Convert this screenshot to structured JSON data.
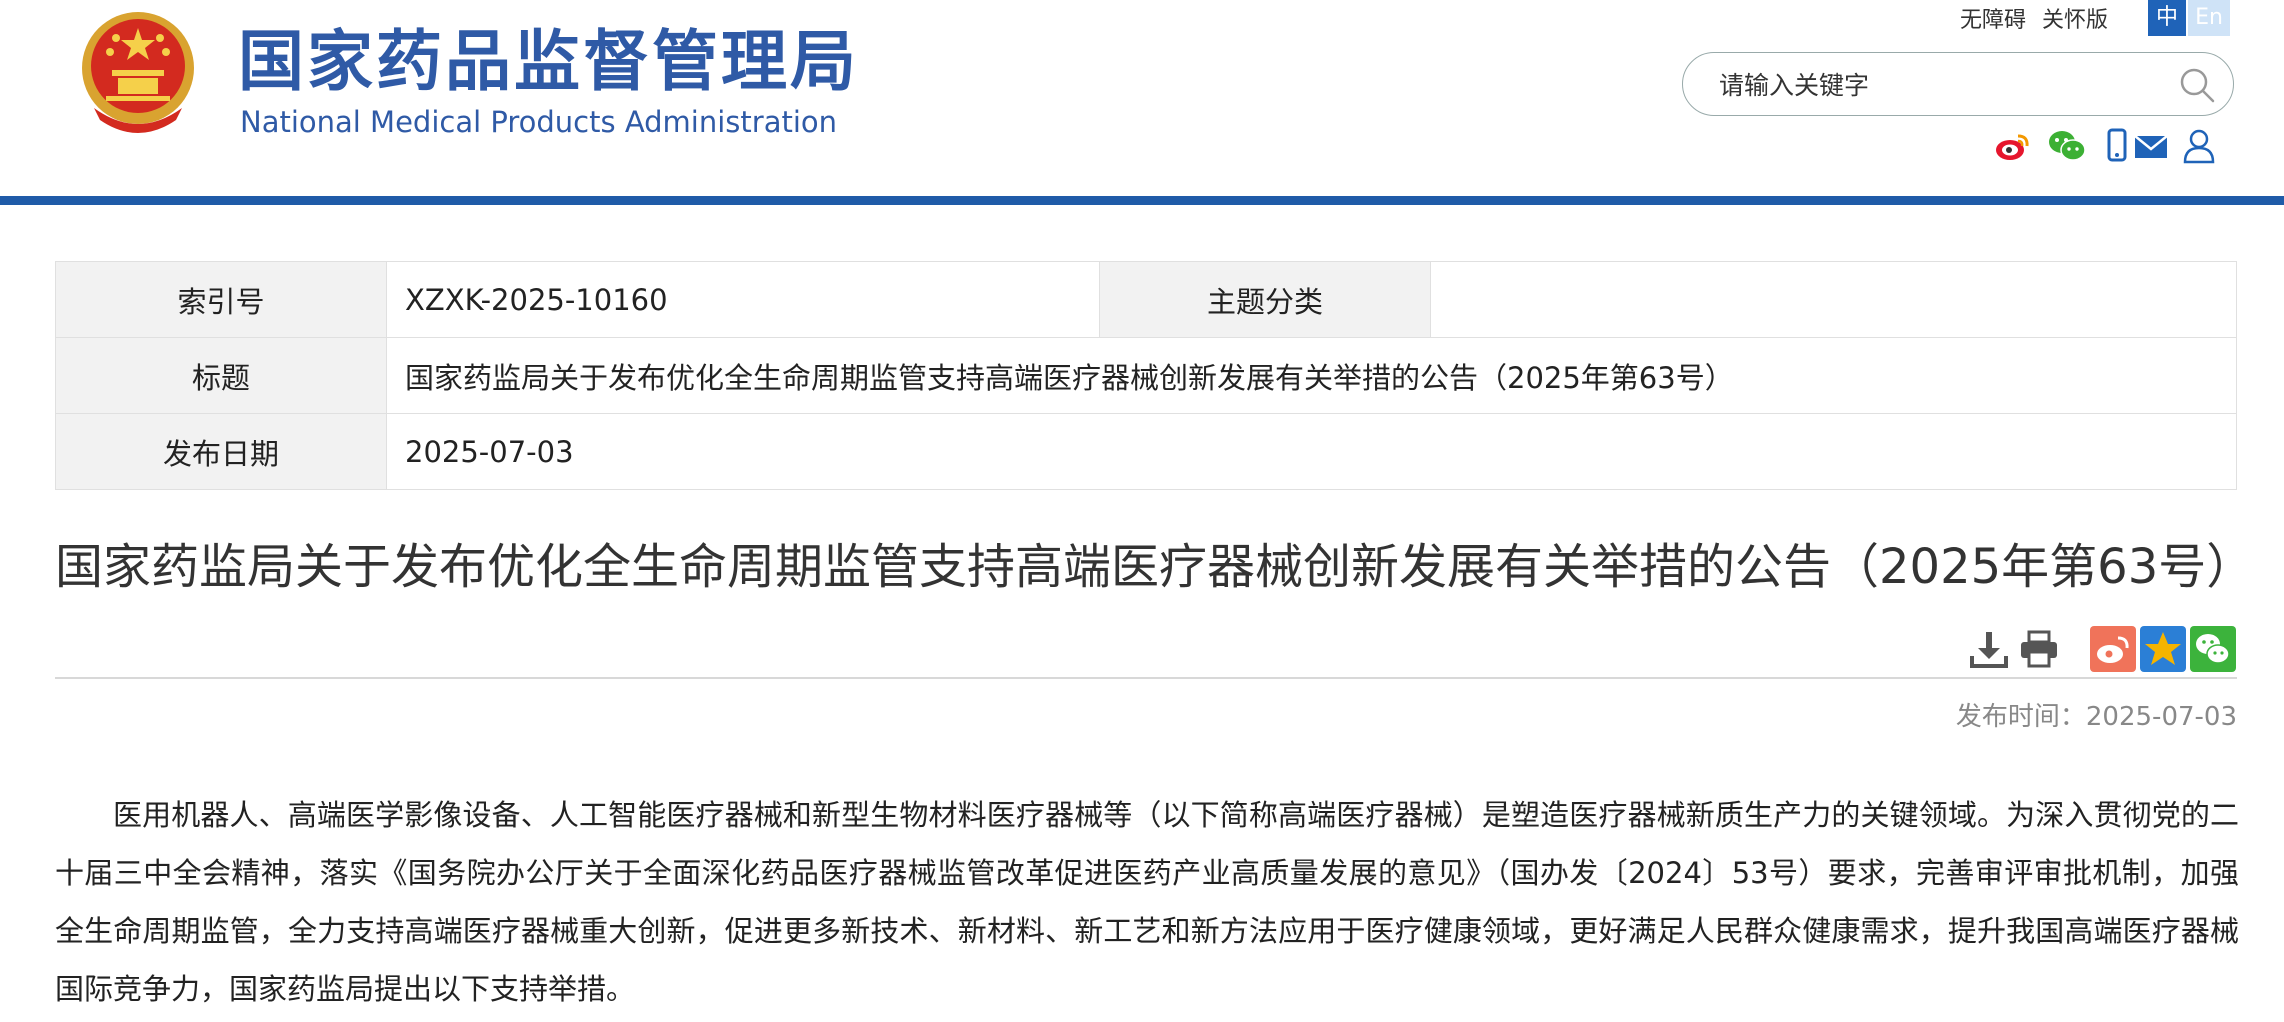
{
  "header": {
    "logo_cn": "国家药品监督管理局",
    "logo_en": "National Medical Products Administration",
    "accessibility": "无障碍",
    "elderly": "关怀版",
    "lang_zh": "中",
    "lang_en": "En",
    "search_placeholder": "请输入关键字",
    "social_icons": [
      "weibo-icon",
      "wechat-icon",
      "mobile-icon",
      "mail-icon",
      "user-icon"
    ]
  },
  "meta": {
    "index_label": "索引号",
    "index_value": "XZXK-2025-10160",
    "category_label": "主题分类",
    "category_value": "",
    "title_label": "标题",
    "title_value": "国家药监局关于发布优化全生命周期监管支持高端医疗器械创新发展有关举措的公告（2025年第63号）",
    "date_label": "发布日期",
    "date_value": "2025-07-03"
  },
  "article": {
    "title": "国家药监局关于发布优化全生命周期监管支持高端医疗器械创新发展有关举措的公告（2025年第63号）",
    "publish_time": "发布时间：2025-07-03",
    "paragraph": "医用机器人、高端医学影像设备、人工智能医疗器械和新型生物材料医疗器械等（以下简称高端医疗器械）是塑造医疗器械新质生产力的关键领域。为深入贯彻党的二十届三中全会精神，落实《国务院办公厅关于全面深化药品医疗器械监管改革促进医药产业高质量发展的意见》（国办发〔2024〕53号）要求，完善审评审批机制，加强全生命周期监管，全力支持高端医疗器械重大创新，促进更多新技术、新材料、新工艺和新方法应用于医疗健康领域，更好满足人民群众健康需求，提升我国高端医疗器械国际竞争力，国家药监局提出以下支持举措。"
  },
  "colors": {
    "brand_blue": "#2f5aa6",
    "header_line": "#1f5ba8",
    "share_weibo": "#f0735a",
    "share_fav": "#f5b400",
    "share_wechat": "#3cb33c"
  }
}
